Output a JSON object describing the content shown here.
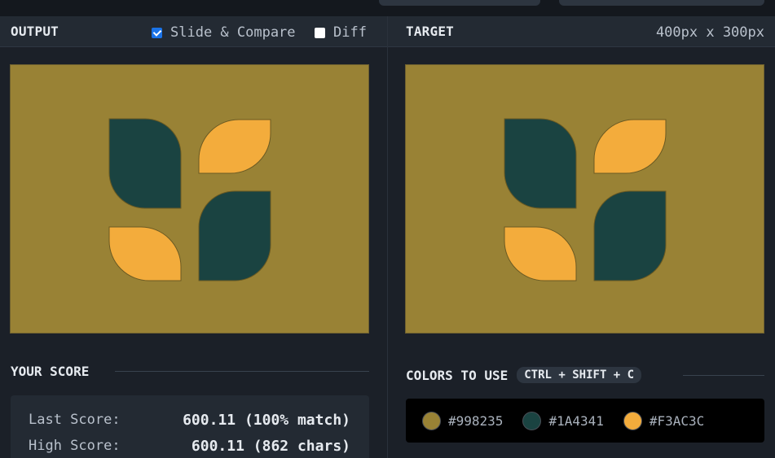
{
  "output": {
    "title": "OUTPUT",
    "slide_compare_label": "Slide & Compare",
    "slide_compare_checked": true,
    "diff_label": "Diff",
    "diff_checked": false
  },
  "target": {
    "title": "TARGET",
    "dimensions": "400px x 300px"
  },
  "score": {
    "title": "YOUR SCORE",
    "last_label": "Last Score:",
    "last_value": "600.11 (100% match)",
    "high_label": "High Score:",
    "high_value": "600.11 (862 chars)"
  },
  "colors": {
    "title": "COLORS TO USE",
    "shortcut": "CTRL + SHIFT + C",
    "swatches": [
      {
        "hex": "#998235",
        "color": "#998235"
      },
      {
        "hex": "#1A4341",
        "color": "#1A4341"
      },
      {
        "hex": "#F3AC3C",
        "color": "#F3AC3C"
      }
    ]
  },
  "canvas_colors": {
    "background": "#998235",
    "dark": "#1A4341",
    "light": "#F3AC3C"
  }
}
